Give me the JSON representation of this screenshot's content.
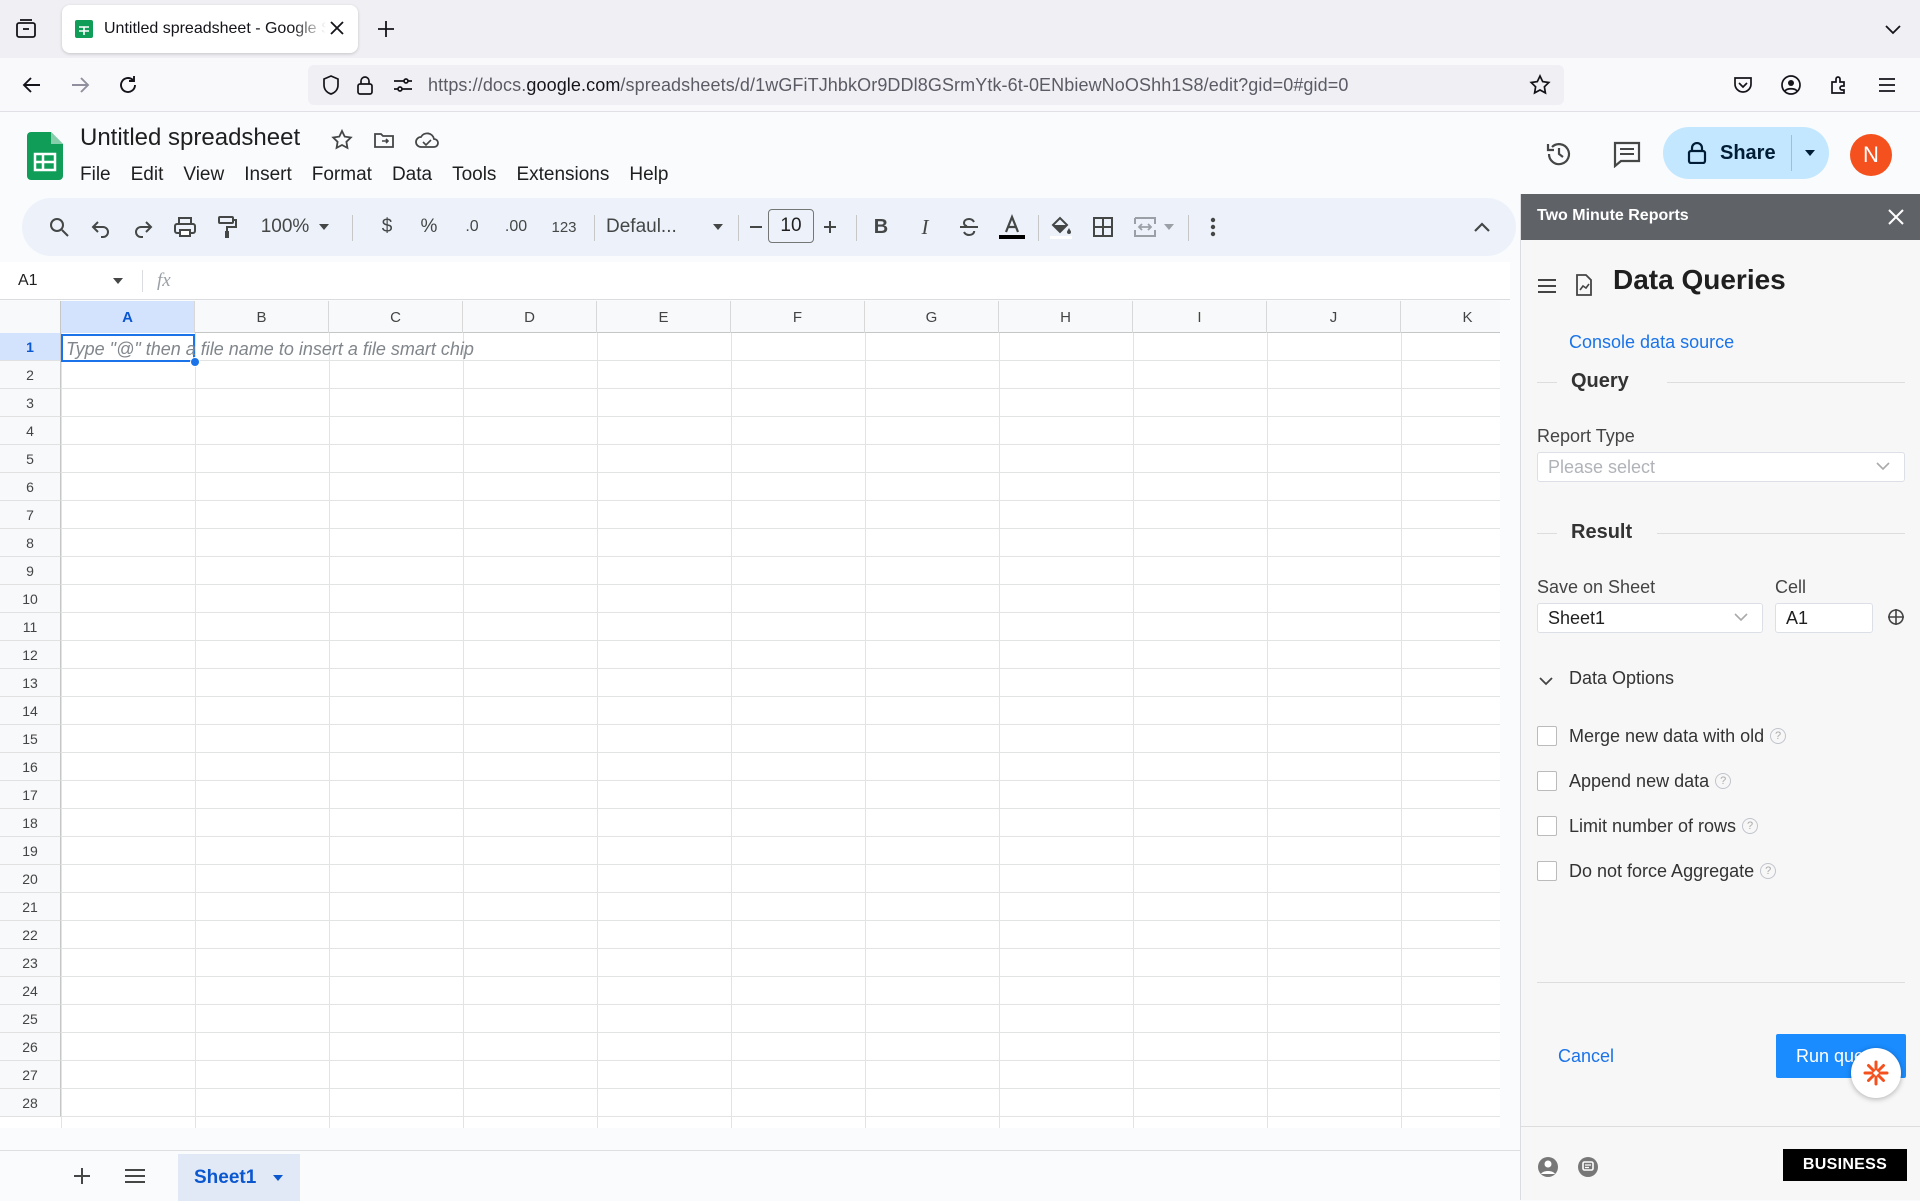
{
  "browser": {
    "tab_title": "Untitled spreadsheet - Google Sheets",
    "url_prefix": "https://docs.",
    "url_domain": "google.com",
    "url_path": "/spreadsheets/d/1wGFiTJhbkOr9DDl8GSrmYtk-6t-0ENbiewNoOShh1S8/edit?gid=0#gid=0"
  },
  "sheets": {
    "doc_title": "Untitled spreadsheet",
    "menu": [
      "File",
      "Edit",
      "View",
      "Insert",
      "Format",
      "Data",
      "Tools",
      "Extensions",
      "Help"
    ],
    "share_label": "Share",
    "avatar_initial": "N",
    "brand_color": "#0f9d58",
    "avatar_color": "#f4511e"
  },
  "toolbar": {
    "zoom": "100%",
    "currency": "$",
    "percent": "%",
    "dec_decrease": ".0",
    "dec_increase": ".00",
    "number_format": "123",
    "font": "Defaul...",
    "font_size": "10",
    "bold": "B",
    "italic": "I"
  },
  "formula": {
    "name_box": "A1",
    "fx": "fx"
  },
  "grid": {
    "columns": [
      "A",
      "B",
      "C",
      "D",
      "E",
      "F",
      "G",
      "H",
      "I",
      "J",
      "K"
    ],
    "rows": [
      "1",
      "2",
      "3",
      "4",
      "5",
      "6",
      "7",
      "8",
      "9",
      "10",
      "11",
      "12",
      "13",
      "14",
      "15",
      "16",
      "17",
      "18",
      "19",
      "20",
      "21",
      "22",
      "23",
      "24",
      "25",
      "26",
      "27",
      "28"
    ],
    "hint": "Type \"@\" then a file name to insert a file smart chip"
  },
  "bottom": {
    "sheet_tab": "Sheet1"
  },
  "sidebar": {
    "title": "Two Minute Reports",
    "heading": "Data Queries",
    "console_link": "Console data source",
    "query_heading": "Query",
    "report_type_label": "Report Type",
    "report_type_placeholder": "Please select",
    "result_heading": "Result",
    "save_on_sheet_label": "Save on Sheet",
    "save_on_sheet_value": "Sheet1",
    "cell_label": "Cell",
    "cell_value": "A1",
    "data_options_label": "Data Options",
    "options": [
      {
        "label": "Merge new data with old",
        "checked": false
      },
      {
        "label": "Append new data",
        "checked": false
      },
      {
        "label": "Limit number of rows",
        "checked": false
      },
      {
        "label": "Do not force Aggregate",
        "checked": false
      }
    ],
    "cancel_label": "Cancel",
    "run_label": "Run query",
    "badge": "BUSINESS",
    "accent_color": "#1a8cff"
  }
}
